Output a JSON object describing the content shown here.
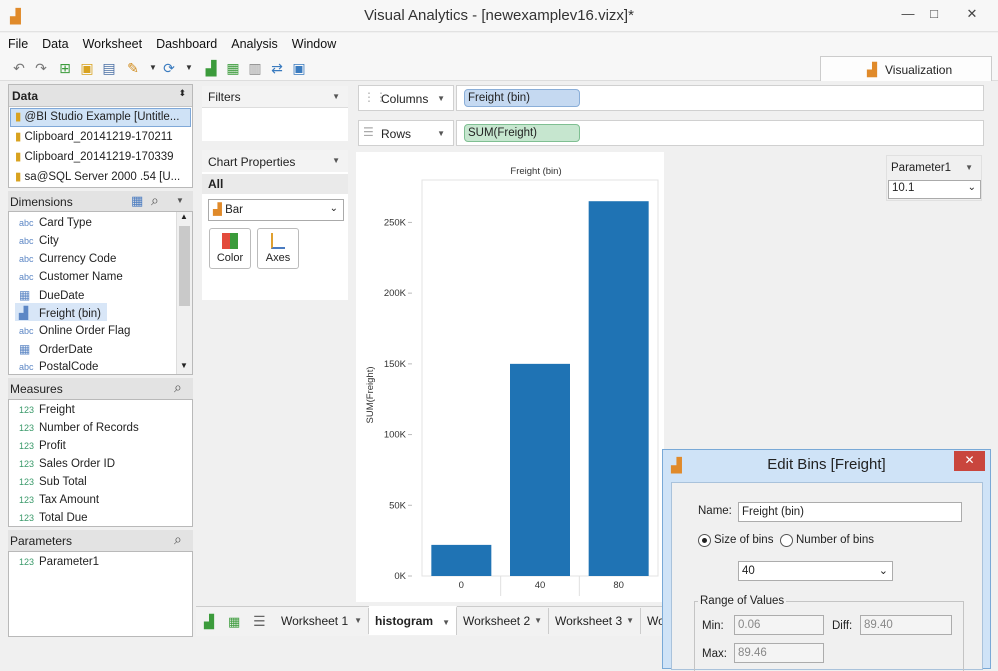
{
  "window": {
    "title": "Visual Analytics - [newexamplev16.vizx]*"
  },
  "menu": [
    "File",
    "Data",
    "Worksheet",
    "Dashboard",
    "Analysis",
    "Window"
  ],
  "toolbar": {
    "visualization_label": "Visualization"
  },
  "data_panel": {
    "title": "Data",
    "sources": [
      "@BI Studio Example [Untitle...",
      "Clipboard_20141219-170211",
      "Clipboard_20141219-170339",
      "sa@SQL Server 2000 .54 [U..."
    ]
  },
  "dimensions": {
    "title": "Dimensions",
    "items": [
      {
        "type": "abc",
        "label": "Card Type"
      },
      {
        "type": "abc",
        "label": "City"
      },
      {
        "type": "abc",
        "label": "Currency Code"
      },
      {
        "type": "abc",
        "label": "Customer Name"
      },
      {
        "type": "date",
        "label": "DueDate"
      },
      {
        "type": "bin",
        "label": "Freight (bin)"
      },
      {
        "type": "abc",
        "label": "Online Order Flag"
      },
      {
        "type": "date",
        "label": "OrderDate"
      },
      {
        "type": "abc",
        "label": "PostalCode"
      }
    ]
  },
  "measures": {
    "title": "Measures",
    "items": [
      {
        "type": "123",
        "label": "Freight"
      },
      {
        "type": "123",
        "label": "Number of Records"
      },
      {
        "type": "123",
        "label": "Profit"
      },
      {
        "type": "123",
        "label": "Sales Order ID"
      },
      {
        "type": "123",
        "label": "Sub Total"
      },
      {
        "type": "123",
        "label": "Tax Amount"
      },
      {
        "type": "123",
        "label": "Total Due"
      }
    ]
  },
  "parameters": {
    "title": "Parameters",
    "items": [
      {
        "type": "123",
        "label": "Parameter1"
      }
    ]
  },
  "filters": {
    "title": "Filters"
  },
  "chart_properties": {
    "title": "Chart Properties",
    "scope": "All",
    "mark_type": "Bar",
    "buttons": [
      "Color",
      "Axes"
    ]
  },
  "shelves": {
    "columns_label": "Columns",
    "columns_pill": "Freight (bin)",
    "rows_label": "Rows",
    "rows_pill": "SUM(Freight)"
  },
  "parameter_control": {
    "label": "Parameter1",
    "value": "10.1"
  },
  "chart_data": {
    "type": "bar",
    "title": "Freight (bin)",
    "xlabel": "",
    "ylabel": "SUM(Freight)",
    "categories": [
      "0",
      "40",
      "80"
    ],
    "values": [
      22000,
      150000,
      265000
    ],
    "ylim": [
      0,
      280000
    ],
    "yticks": [
      0,
      50000,
      100000,
      150000,
      200000,
      250000
    ],
    "ytick_labels": [
      "0K",
      "50K",
      "100K",
      "150K",
      "200K",
      "250K"
    ],
    "bar_color": "#1f73b4",
    "grid": false
  },
  "tabs": [
    "Worksheet 1",
    "histogram",
    "Worksheet 2",
    "Worksheet 3",
    "Wo"
  ],
  "active_tab": "histogram",
  "dialog": {
    "title": "Edit Bins [Freight]",
    "name_label": "Name:",
    "name_value": "Freight (bin)",
    "size_option": "Size of bins",
    "number_option": "Number of bins",
    "size_value": "40",
    "range_title": "Range of Values",
    "min_label": "Min:",
    "min_value": "0.06",
    "diff_label": "Diff:",
    "diff_value": "89.40",
    "max_label": "Max:",
    "max_value": "89.46"
  },
  "colors": {
    "accent": "#1f73b4",
    "columns_pill": "#c5d9f1",
    "rows_pill": "#c6e6cf"
  }
}
